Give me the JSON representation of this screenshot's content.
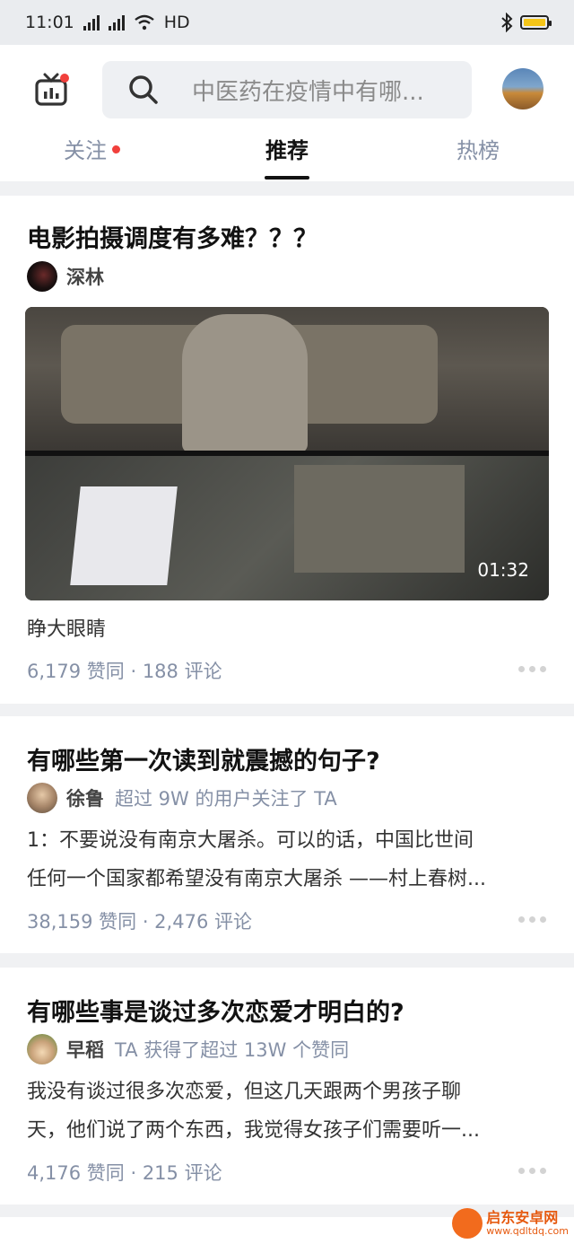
{
  "status_bar": {
    "time": "11:01",
    "network": "HD",
    "net_4g_1": "4G",
    "net_4g_2": "4G",
    "battery_color": "#f5c518"
  },
  "header": {
    "search_placeholder": "中医药在疫情中有哪...",
    "icons": [
      "tv-icon",
      "search-icon",
      "avatar"
    ]
  },
  "tabs": [
    {
      "label": "关注",
      "active": false,
      "has_dot": true
    },
    {
      "label": "推荐",
      "active": true
    },
    {
      "label": "热榜",
      "active": false
    }
  ],
  "feed": [
    {
      "title": "电影拍摄调度有多难？？？",
      "author": "深林",
      "author_meta": "",
      "video_duration": "01:32",
      "excerpt_lines": [
        "睁大眼睛"
      ],
      "stats": "6,179 赞同 · 188 评论"
    },
    {
      "title": "有哪些第一次读到就震撼的句子?",
      "author": "徐鲁",
      "author_meta": "超过 9W 的用户关注了 TA",
      "excerpt_lines": [
        "1：不要说没有南京大屠杀。可以的话，中国比世间",
        "任何一个国家都希望没有南京大屠杀 ——村上春树..."
      ],
      "stats": "38,159 赞同 · 2,476 评论"
    },
    {
      "title": "有哪些事是谈过多次恋爱才明白的?",
      "author": "早稻",
      "author_meta": "TA 获得了超过 13W 个赞同",
      "excerpt_lines": [
        "我没有谈过很多次恋爱，但这几天跟两个男孩子聊",
        "天，他们说了两个东西，我觉得女孩子们需要听一..."
      ],
      "stats": "4,176 赞同 · 215 评论"
    }
  ],
  "watermark": {
    "title": "启东安卓网",
    "url": "www.qdltdq.com"
  },
  "colors": {
    "accent_dot": "#f1403c",
    "muted_text": "#8590a6",
    "page_bg": "#f0f1f3"
  }
}
